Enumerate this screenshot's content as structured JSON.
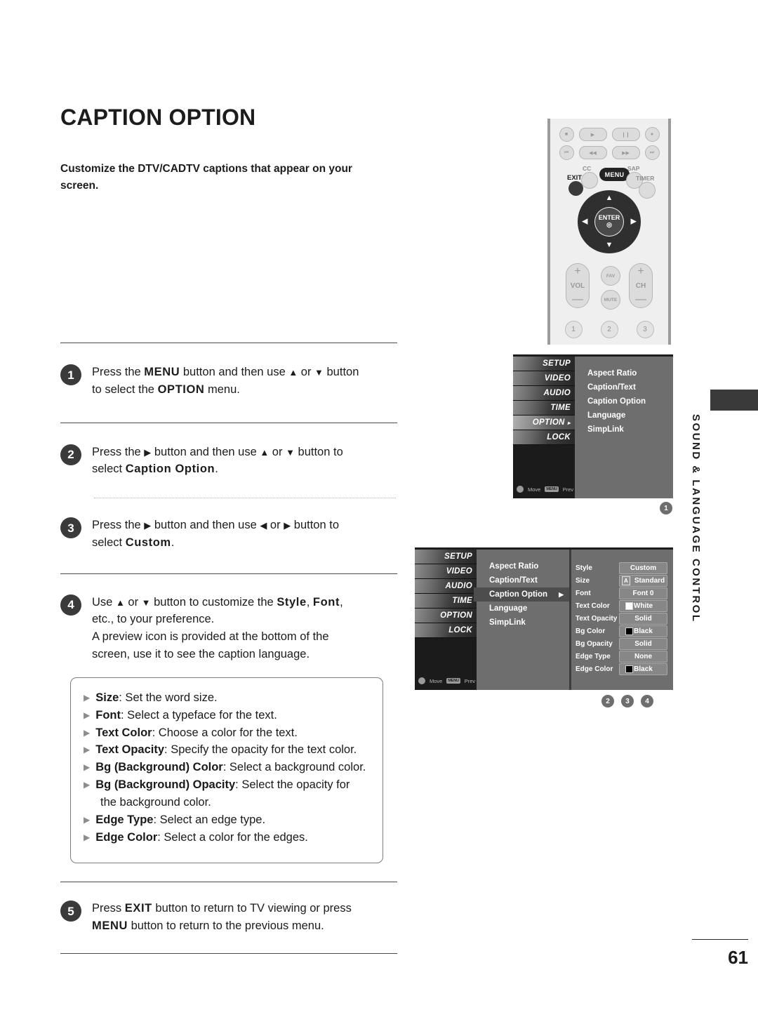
{
  "document": {
    "title": "CAPTION OPTION",
    "intro": "Customize the DTV/CADTV captions that appear on your screen.",
    "page_number": "61",
    "side_tab": "SOUND & LANGUAGE CONTROL"
  },
  "steps": [
    {
      "number": "1",
      "line1_a": "Press the ",
      "line1_b": "MENU",
      "line1_c": " button and then use ",
      "line1_up": "▲",
      "line1_or": " or ",
      "line1_down": "▼",
      "line1_d": " button",
      "line2_a": "to select the ",
      "line2_b": "OPTION",
      "line2_c": " menu."
    },
    {
      "number": "2",
      "line1_a": "Press the ",
      "line1_arrow": "▶",
      "line1_b": " button and then use ",
      "line1_up": "▲",
      "line1_or": " or ",
      "line1_down": "▼",
      "line1_c": " button to",
      "line2_a": "select ",
      "line2_b": "Caption Option",
      "line2_c": "."
    },
    {
      "number": "3",
      "line1_a": "Press the ",
      "line1_arrow": "▶",
      "line1_b": " button and then use ",
      "line1_left": "◀",
      "line1_or": " or ",
      "line1_right": "▶",
      "line1_c": " button to",
      "line2_a": "select ",
      "line2_b": "Custom",
      "line2_c": "."
    },
    {
      "number": "4",
      "line1_a": "Use ",
      "line1_up": "▲",
      "line1_or": " or ",
      "line1_down": "▼",
      "line1_b": " button to customize the ",
      "line1_style": "Style",
      "line1_comma": ", ",
      "line1_font": "Font",
      "line1_c": ",",
      "line2": "etc., to your preference.",
      "line3": "A preview icon is provided at the bottom of the",
      "line4": "screen, use it to see the caption language."
    },
    {
      "number": "5",
      "line1_a": "Press ",
      "line1_b": "EXIT",
      "line1_c": " button to return to TV viewing or press",
      "line2_a": "MENU",
      "line2_b": " button to return to the previous menu."
    }
  ],
  "bullets": [
    {
      "term": "Size",
      "desc": ": Set the word size."
    },
    {
      "term": "Font",
      "desc": ": Select a typeface for the text."
    },
    {
      "term": "Text Color",
      "desc": ": Choose a color for the text."
    },
    {
      "term": "Text Opacity",
      "desc": ": Specify the opacity for the text color."
    },
    {
      "term": "Bg (Background) Color",
      "desc": ": Select a background color."
    },
    {
      "term": "Bg (Background) Opacity",
      "desc": ": Select the opacity for"
    },
    {
      "term": "",
      "desc": "the background color.",
      "continuation": true
    },
    {
      "term": "Edge Type",
      "desc": ": Select an edge type."
    },
    {
      "term": "Edge Color",
      "desc": ": Select a color for the edges."
    }
  ],
  "remote": {
    "transport_top": [
      "stop-icon",
      "play-icon",
      "pause-icon",
      "record-icon"
    ],
    "transport_bottom": [
      "skip-back-icon",
      "rewind-icon",
      "fast-forward-icon",
      "skip-forward-icon"
    ],
    "labels": {
      "cc": "CC",
      "menu": "MENU",
      "sap": "SAP",
      "exit": "EXIT",
      "timer": "TIMER",
      "enter": "ENTER",
      "vol": "VOL",
      "ch": "CH",
      "fav": "FAV",
      "mute": "MUTE",
      "plus": "+",
      "minus": "—",
      "up": "▲",
      "down": "▼",
      "left": "◀",
      "right": "▶"
    },
    "numbers": [
      "1",
      "2",
      "3"
    ]
  },
  "osd1": {
    "rail": [
      "SETUP",
      "VIDEO",
      "AUDIO",
      "TIME",
      "OPTION",
      "LOCK"
    ],
    "rail_active": "OPTION",
    "rail_chevron": "▸",
    "footer": {
      "move": "Move",
      "prev": "Prev",
      "prev_key": "MENU"
    },
    "items": [
      "Aspect Ratio",
      "Caption/Text",
      "Caption Option",
      "Language",
      "SimpLink"
    ],
    "marker": "1"
  },
  "osd2": {
    "rail": [
      "SETUP",
      "VIDEO",
      "AUDIO",
      "TIME",
      "OPTION",
      "LOCK"
    ],
    "footer": {
      "move": "Move",
      "prev": "Prev",
      "prev_key": "MENU"
    },
    "items": [
      "Aspect Ratio",
      "Caption/Text",
      "Caption Option",
      "Language",
      "SimpLink"
    ],
    "selected_item": "Caption Option",
    "selected_chevron": "▶",
    "values": [
      {
        "label": "Style",
        "value": "Custom",
        "swatch": "none",
        "icon": "none"
      },
      {
        "label": "Size",
        "value": "Standard",
        "swatch": "none",
        "icon": "A"
      },
      {
        "label": "Font",
        "value": "Font  0",
        "swatch": "none",
        "icon": "none"
      },
      {
        "label": "Text Color",
        "value": "White",
        "swatch": "white",
        "icon": "none"
      },
      {
        "label": "Text Opacity",
        "value": "Solid",
        "swatch": "none",
        "icon": "none"
      },
      {
        "label": "Bg Color",
        "value": "Black",
        "swatch": "black",
        "icon": "none"
      },
      {
        "label": "Bg Opacity",
        "value": "Solid",
        "swatch": "none",
        "icon": "none"
      },
      {
        "label": "Edge Type",
        "value": "None",
        "swatch": "none",
        "icon": "none"
      },
      {
        "label": "Edge Color",
        "value": "Black",
        "swatch": "black",
        "icon": "none"
      }
    ],
    "markers": [
      "2",
      "3",
      "4"
    ]
  }
}
